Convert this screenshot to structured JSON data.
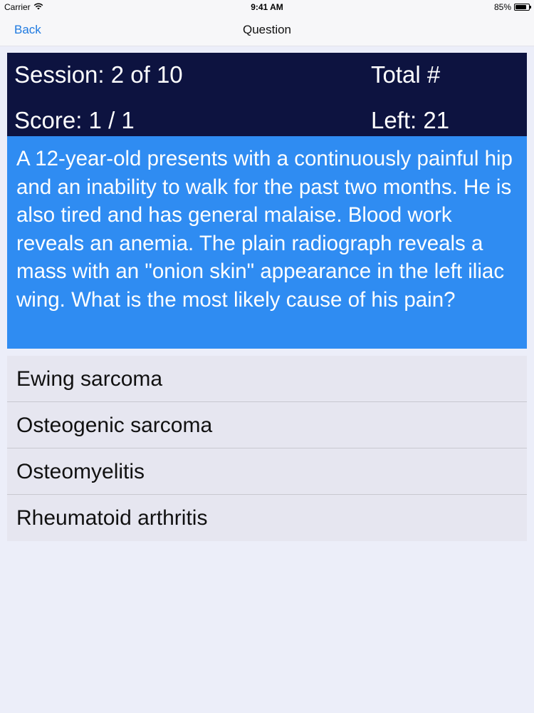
{
  "status_bar": {
    "carrier": "Carrier",
    "time": "9:41 AM",
    "battery": "85%",
    "battery_level": 0.85,
    "wifi_icon": "wifi-icon"
  },
  "nav": {
    "back_label": "Back",
    "title": "Question"
  },
  "score_panel": {
    "session": "Session: 2 of 10",
    "total_label": "Total #",
    "score": "Score: 1 / 1",
    "left": "Left: 21"
  },
  "question": {
    "text": "A 12-year-old presents with a continuously painful hip and an inability to walk for the past two months. He is also tired and has general malaise. Blood work reveals an anemia. The plain radiograph reveals a mass with an \"onion skin\" appearance in the left iliac wing. What is the most likely cause of his pain?"
  },
  "answers": [
    {
      "label": "Ewing sarcoma"
    },
    {
      "label": "Osteogenic sarcoma"
    },
    {
      "label": "Osteomyelitis"
    },
    {
      "label": "Rheumatoid arthritis"
    }
  ],
  "colors": {
    "score_panel_bg": "#0d1340",
    "question_bg": "#2f8cf2",
    "answers_bg": "#e6e6f0",
    "page_bg": "#eceef9",
    "link": "#1f7ae0"
  }
}
